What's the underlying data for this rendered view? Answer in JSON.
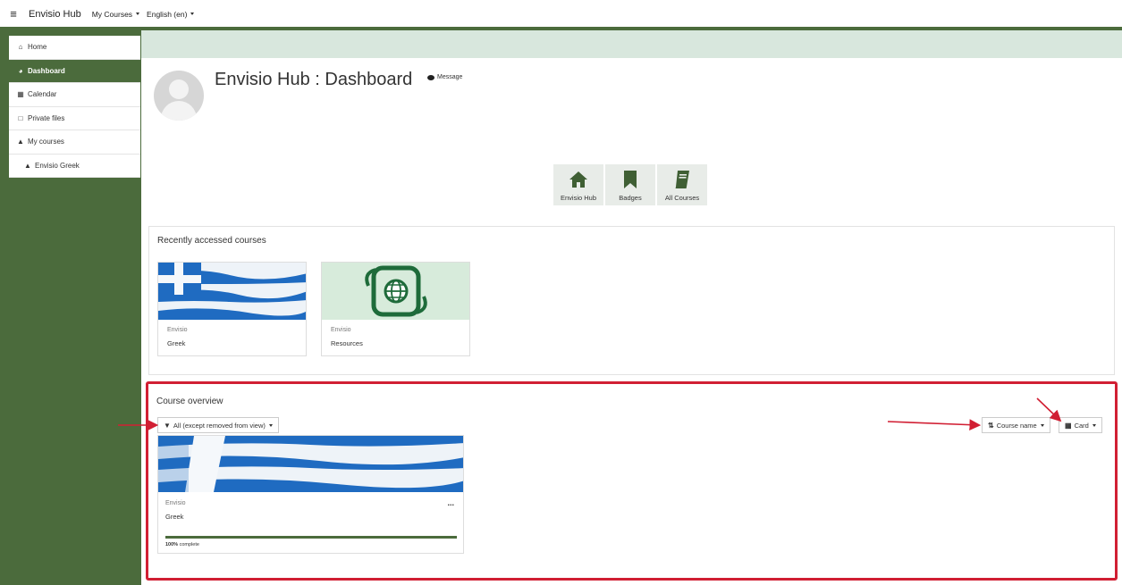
{
  "navbar": {
    "brand": "Envisio Hub",
    "menus": [
      {
        "label": "My Courses"
      },
      {
        "label": "English (en)"
      }
    ]
  },
  "sidebar": {
    "items": [
      {
        "label": "Home",
        "icon": "home-icon",
        "active": false
      },
      {
        "label": "Dashboard",
        "icon": "dashboard-icon",
        "active": true
      },
      {
        "label": "Calendar",
        "icon": "calendar-icon",
        "active": false
      },
      {
        "label": "Private files",
        "icon": "file-icon",
        "active": false
      },
      {
        "label": "My courses",
        "icon": "graduation-cap-icon",
        "active": false
      },
      {
        "label": "Envisio Greek",
        "icon": "graduation-cap-icon",
        "active": false
      }
    ]
  },
  "header": {
    "title": "Envisio Hub : Dashboard",
    "message_label": "Message"
  },
  "quicklinks": [
    {
      "label": "Envisio Hub",
      "icon": "home-icon"
    },
    {
      "label": "Badges",
      "icon": "bookmark-icon"
    },
    {
      "label": "All Courses",
      "icon": "book-icon"
    }
  ],
  "recent": {
    "title": "Recently accessed courses",
    "courses": [
      {
        "category": "Envisio",
        "name": "Greek",
        "image": "greek-flag"
      },
      {
        "category": "Envisio",
        "name": "Resources",
        "image": "resources-globe"
      }
    ]
  },
  "overview": {
    "title": "Course overview",
    "filter_label": "All (except removed from view)",
    "sort_label": "Course name",
    "view_label": "Card",
    "course": {
      "category": "Envisio",
      "name": "Greek",
      "menu": "...",
      "progress_percent": 100,
      "progress_value": "100%",
      "progress_suffix": " complete"
    }
  },
  "colors": {
    "brand_green": "#4b6b3c",
    "header_band": "#d8e7dd",
    "annotation_red": "#d11f33",
    "flag_blue": "#1f6bc1"
  }
}
